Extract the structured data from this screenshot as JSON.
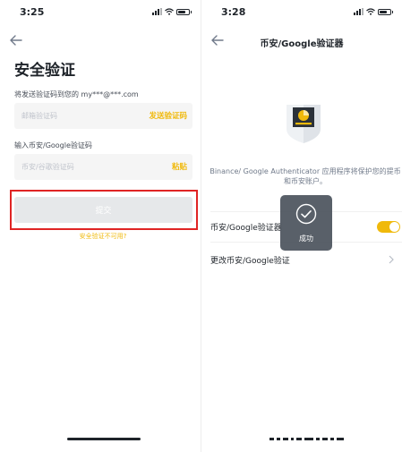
{
  "left": {
    "status": {
      "time": "3:25"
    },
    "title": "安全验证",
    "email": {
      "label": "将发送验证码到您的 my***@***.com",
      "placeholder": "邮箱验证码",
      "action": "发送验证码"
    },
    "authenticator": {
      "label": "输入币安/Google验证码",
      "placeholder": "币安/谷歌验证码",
      "action": "粘贴"
    },
    "submit_label": "提交",
    "unavailable_link": "安全验证不可用?"
  },
  "right": {
    "status": {
      "time": "3:28"
    },
    "nav_title": "币安/Google验证器",
    "description": "Binance/ Google Authenticator 应用程序将保护您的提币和币安账户。",
    "rows": [
      {
        "label": "币安/Google验证器",
        "enabled": true
      },
      {
        "label": "更改币安/Google验证"
      }
    ],
    "toast": "成功"
  },
  "colors": {
    "accent": "#f0b90b",
    "highlight": "#e02424",
    "text": "#1e2329",
    "muted": "#707a8a",
    "input_bg": "#f5f5f5",
    "disabled_btn": "#e6e8ea"
  },
  "icons": [
    "back-arrow-icon",
    "chevron-right-icon",
    "check-circle-icon",
    "authenticator-illustration",
    "signal-icon",
    "wifi-icon",
    "battery-icon"
  ]
}
